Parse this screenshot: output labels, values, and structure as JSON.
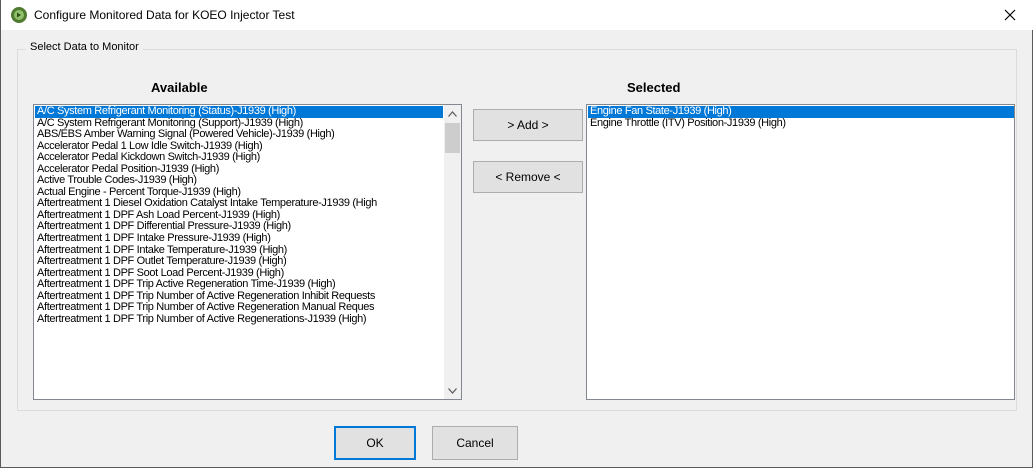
{
  "window": {
    "title": "Configure Monitored Data for KOEO Injector Test",
    "app_icon": "green-globe-icon",
    "close_symbol": "✕"
  },
  "group": {
    "legend": "Select Data to Monitor"
  },
  "available": {
    "heading": "Available",
    "items": [
      "A/C System Refrigerant Monitoring (Status)-J1939 (High)",
      "A/C System Refrigerant Monitoring (Support)-J1939 (High)",
      "ABS/EBS Amber Warning Signal (Powered Vehicle)-J1939 (High)",
      "Accelerator Pedal 1 Low Idle Switch-J1939 (High)",
      "Accelerator Pedal Kickdown Switch-J1939 (High)",
      "Accelerator Pedal Position-J1939 (High)",
      "Active Trouble Codes-J1939 (High)",
      "Actual Engine - Percent Torque-J1939 (High)",
      "Aftertreatment 1 Diesel Oxidation Catalyst Intake Temperature-J1939 (High",
      "Aftertreatment 1 DPF Ash Load Percent-J1939 (High)",
      "Aftertreatment 1 DPF Differential Pressure-J1939 (High)",
      "Aftertreatment 1 DPF Intake Pressure-J1939 (High)",
      "Aftertreatment 1 DPF Intake Temperature-J1939 (High)",
      "Aftertreatment 1 DPF Outlet Temperature-J1939 (High)",
      "Aftertreatment 1 DPF Soot Load Percent-J1939 (High)",
      "Aftertreatment 1 DPF Trip Active Regeneration Time-J1939 (High)",
      "Aftertreatment 1 DPF Trip Number of Active Regeneration Inhibit Requests",
      "Aftertreatment 1 DPF Trip Number of Active Regeneration Manual Reques",
      "Aftertreatment 1 DPF Trip Number of Active Regenerations-J1939 (High)"
    ],
    "selected_index": 0
  },
  "selected": {
    "heading": "Selected",
    "items": [
      "Engine Fan State-J1939 (High)",
      "Engine Throttle (ITV) Position-J1939 (High)"
    ],
    "selected_index": 0
  },
  "buttons": {
    "add": "> Add >",
    "remove": "< Remove <",
    "ok": "OK",
    "cancel": "Cancel"
  },
  "colors": {
    "selection": "#0078d7",
    "default_button_border": "#0078d7",
    "app_icon": "#4f7a2f"
  }
}
